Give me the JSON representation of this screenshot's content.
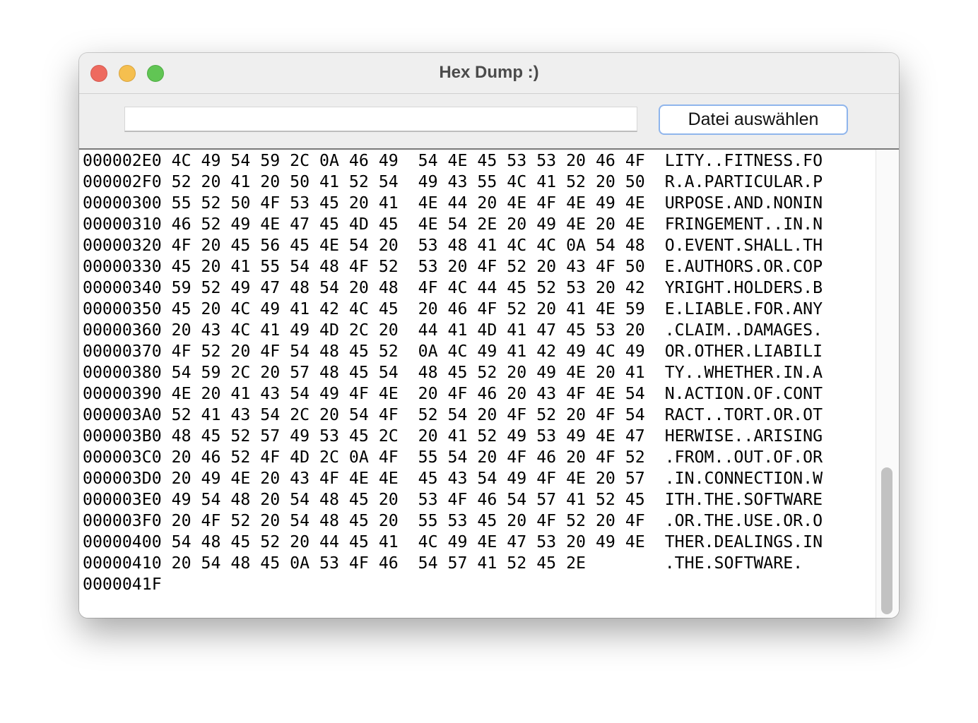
{
  "window": {
    "title": "Hex Dump :)"
  },
  "toolbar": {
    "path_value": "",
    "choose_file_label": "Datei auswählen"
  },
  "rows": [
    {
      "addr": "000002E0",
      "hex1": "4C 49 54 59 2C 0A 46 49",
      "hex2": "54 4E 45 53 53 20 46 4F",
      "ascii": "LITY..FITNESS.FO"
    },
    {
      "addr": "000002F0",
      "hex1": "52 20 41 20 50 41 52 54",
      "hex2": "49 43 55 4C 41 52 20 50",
      "ascii": "R.A.PARTICULAR.P"
    },
    {
      "addr": "00000300",
      "hex1": "55 52 50 4F 53 45 20 41",
      "hex2": "4E 44 20 4E 4F 4E 49 4E",
      "ascii": "URPOSE.AND.NONIN"
    },
    {
      "addr": "00000310",
      "hex1": "46 52 49 4E 47 45 4D 45",
      "hex2": "4E 54 2E 20 49 4E 20 4E",
      "ascii": "FRINGEMENT..IN.N"
    },
    {
      "addr": "00000320",
      "hex1": "4F 20 45 56 45 4E 54 20",
      "hex2": "53 48 41 4C 4C 0A 54 48",
      "ascii": "O.EVENT.SHALL.TH"
    },
    {
      "addr": "00000330",
      "hex1": "45 20 41 55 54 48 4F 52",
      "hex2": "53 20 4F 52 20 43 4F 50",
      "ascii": "E.AUTHORS.OR.COP"
    },
    {
      "addr": "00000340",
      "hex1": "59 52 49 47 48 54 20 48",
      "hex2": "4F 4C 44 45 52 53 20 42",
      "ascii": "YRIGHT.HOLDERS.B"
    },
    {
      "addr": "00000350",
      "hex1": "45 20 4C 49 41 42 4C 45",
      "hex2": "20 46 4F 52 20 41 4E 59",
      "ascii": "E.LIABLE.FOR.ANY"
    },
    {
      "addr": "00000360",
      "hex1": "20 43 4C 41 49 4D 2C 20",
      "hex2": "44 41 4D 41 47 45 53 20",
      "ascii": ".CLAIM..DAMAGES."
    },
    {
      "addr": "00000370",
      "hex1": "4F 52 20 4F 54 48 45 52",
      "hex2": "0A 4C 49 41 42 49 4C 49",
      "ascii": "OR.OTHER.LIABILI"
    },
    {
      "addr": "00000380",
      "hex1": "54 59 2C 20 57 48 45 54",
      "hex2": "48 45 52 20 49 4E 20 41",
      "ascii": "TY..WHETHER.IN.A"
    },
    {
      "addr": "00000390",
      "hex1": "4E 20 41 43 54 49 4F 4E",
      "hex2": "20 4F 46 20 43 4F 4E 54",
      "ascii": "N.ACTION.OF.CONT"
    },
    {
      "addr": "000003A0",
      "hex1": "52 41 43 54 2C 20 54 4F",
      "hex2": "52 54 20 4F 52 20 4F 54",
      "ascii": "RACT..TORT.OR.OT"
    },
    {
      "addr": "000003B0",
      "hex1": "48 45 52 57 49 53 45 2C",
      "hex2": "20 41 52 49 53 49 4E 47",
      "ascii": "HERWISE..ARISING"
    },
    {
      "addr": "000003C0",
      "hex1": "20 46 52 4F 4D 2C 0A 4F",
      "hex2": "55 54 20 4F 46 20 4F 52",
      "ascii": ".FROM..OUT.OF.OR"
    },
    {
      "addr": "000003D0",
      "hex1": "20 49 4E 20 43 4F 4E 4E",
      "hex2": "45 43 54 49 4F 4E 20 57",
      "ascii": ".IN.CONNECTION.W"
    },
    {
      "addr": "000003E0",
      "hex1": "49 54 48 20 54 48 45 20",
      "hex2": "53 4F 46 54 57 41 52 45",
      "ascii": "ITH.THE.SOFTWARE"
    },
    {
      "addr": "000003F0",
      "hex1": "20 4F 52 20 54 48 45 20",
      "hex2": "55 53 45 20 4F 52 20 4F",
      "ascii": ".OR.THE.USE.OR.O"
    },
    {
      "addr": "00000400",
      "hex1": "54 48 45 52 20 44 45 41",
      "hex2": "4C 49 4E 47 53 20 49 4E",
      "ascii": "THER.DEALINGS.IN"
    },
    {
      "addr": "00000410",
      "hex1": "20 54 48 45 0A 53 4F 46",
      "hex2": "54 57 41 52 45 2E      ",
      "ascii": ".THE.SOFTWARE."
    },
    {
      "addr": "0000041F",
      "hex1": "",
      "hex2": "",
      "ascii": ""
    }
  ],
  "scroll": {
    "position_fraction": 1.0
  }
}
